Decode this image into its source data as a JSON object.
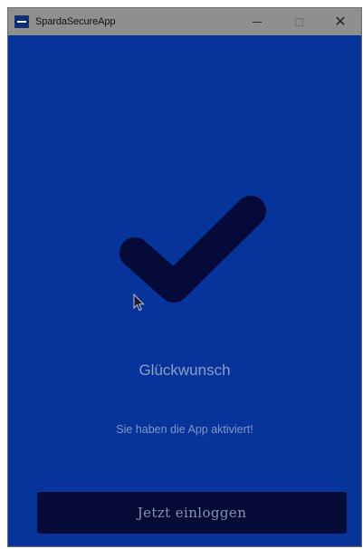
{
  "window": {
    "title": "SpardaSecureApp",
    "controls": {
      "minimize": "minimize-icon",
      "maximize": "maximize-icon",
      "close": "close-icon"
    }
  },
  "main": {
    "icon": "checkmark-icon",
    "headline": "Glückwunsch",
    "message": "Sie haben die App aktiviert!",
    "login_button_label": "Jetzt einloggen"
  },
  "colors": {
    "background": "#07349a",
    "titlebar": "#8f8f8f",
    "checkmark": "#060a38",
    "button": "#070b38",
    "text": "#8e9fc6"
  }
}
